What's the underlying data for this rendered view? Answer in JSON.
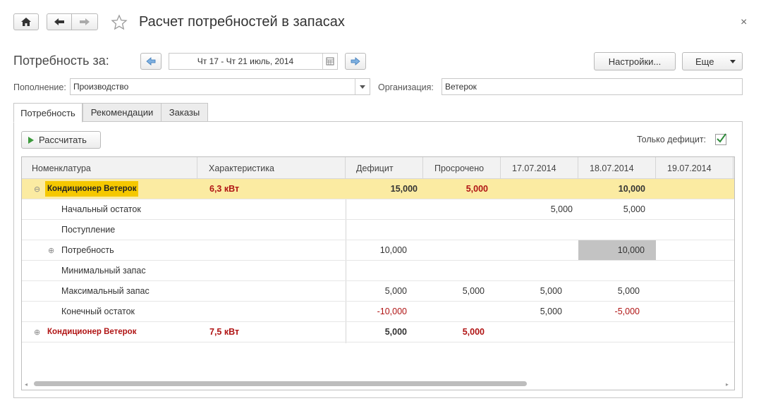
{
  "window": {
    "title": "Расчет потребностей в запасах",
    "close_glyph": "×"
  },
  "period": {
    "label": "Потребность за:",
    "value": "Чт 17 - Чт 21 июль, 2014"
  },
  "buttons": {
    "settings": "Настройки...",
    "more": "Еще",
    "calculate": "Рассчитать"
  },
  "filters": {
    "replenishment_label": "Пополнение:",
    "replenishment_value": "Производство",
    "organization_label": "Организация:",
    "organization_value": "Ветерок"
  },
  "tabs": [
    "Потребность",
    "Рекомендации",
    "Заказы"
  ],
  "deficit_only_label": "Только дефицит:",
  "table": {
    "headers": [
      "Номенклатура",
      "Характеристика",
      "Дефицит",
      "Просрочено",
      "17.07.2014",
      "18.07.2014",
      "19.07.2014"
    ],
    "group1": {
      "name": "Кондиционер Ветерок",
      "char": "6,3 кВт",
      "deficit": "15,000",
      "overdue": "5,000",
      "d17": "",
      "d18": "10,000"
    },
    "rows": [
      {
        "name": "Начальный остаток",
        "deficit": "",
        "overdue": "",
        "d17": "5,000",
        "d18": "5,000"
      },
      {
        "name": "Поступление",
        "deficit": "",
        "overdue": "",
        "d17": "",
        "d18": ""
      },
      {
        "name": "Потребность",
        "deficit": "10,000",
        "overdue": "",
        "d17": "",
        "d18": "10,000"
      },
      {
        "name": "Минимальный запас",
        "deficit": "",
        "overdue": "",
        "d17": "",
        "d18": ""
      },
      {
        "name": "Максимальный запас",
        "deficit": "5,000",
        "overdue": "5,000",
        "d17": "5,000",
        "d18": "5,000"
      },
      {
        "name": "Конечный остаток",
        "deficit": "-10,000",
        "overdue": "",
        "d17": "5,000",
        "d18": "-5,000"
      }
    ],
    "group2": {
      "name": "Кондиционер Ветерок",
      "char": "7,5 кВт",
      "deficit": "5,000",
      "overdue": "5,000"
    }
  },
  "colors": {
    "selected_row": "#fbeba2",
    "negative": "#b01414",
    "highlight_cell": "#c3c3c3",
    "checkbox": "#2e8b3a"
  }
}
